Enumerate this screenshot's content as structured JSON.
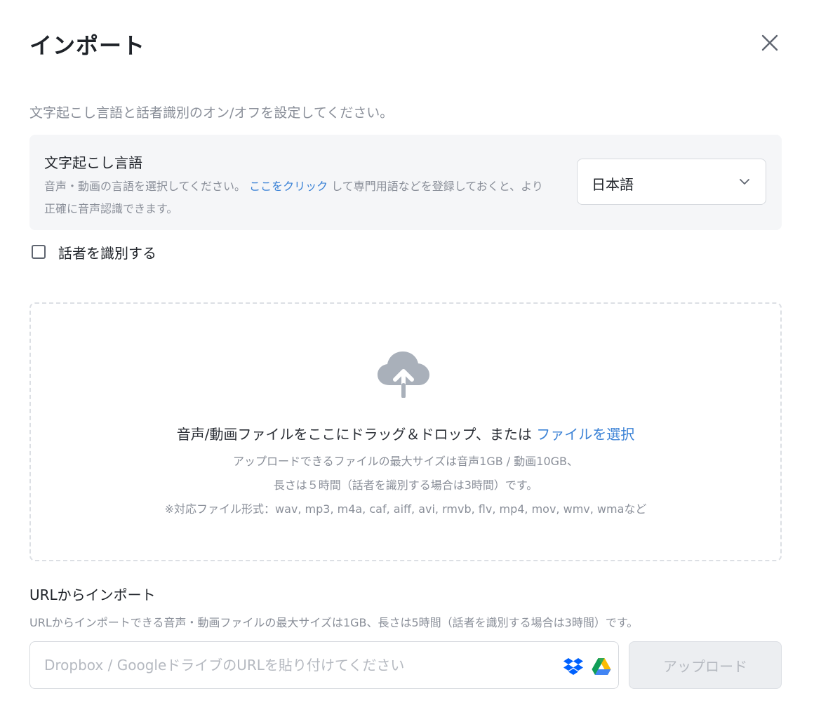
{
  "dialog": {
    "title": "インポート",
    "intro": "文字起こし言語と話者識別のオン/オフを設定してください。"
  },
  "language": {
    "title": "文字起こし言語",
    "desc_before": "音声・動画の言語を選択してください。",
    "desc_link": "ここをクリック",
    "desc_after": "して専門用語などを登録しておくと、より正確に音声認識できます。",
    "selected": "日本語"
  },
  "speaker": {
    "label": "話者を識別する",
    "checked": false
  },
  "dropzone": {
    "main_text": "音声/動画ファイルをここにドラッグ＆ドロップ、または",
    "main_link": "ファイルを選択",
    "info_line1": "アップロードできるファイルの最大サイズは音声1GB / 動画10GB、",
    "info_line2": "長さは５時間（話者を識別する場合は3時間）です。",
    "info_line3": "※対応ファイル形式：wav, mp3, m4a, caf, aiff, avi, rmvb, flv, mp4, mov, wmv, wmaなど"
  },
  "url_import": {
    "title": "URLからインポート",
    "desc": "URLからインポートできる音声・動画ファイルの最大サイズは1GB、長さは5時間（話者を識別する場合は3時間）です。",
    "placeholder": "Dropbox / GoogleドライブのURLを貼り付けてください",
    "value": "",
    "upload_label": "アップロード"
  },
  "icons": {
    "close": "close-icon",
    "chevron": "chevron-down-icon",
    "cloud": "cloud-upload-icon",
    "dropbox": "dropbox-icon",
    "gdrive": "google-drive-icon"
  },
  "colors": {
    "link": "#3b82d6",
    "muted": "#8a8f99",
    "panel_bg": "#f5f6f8",
    "cloud": "#a9b0ba",
    "dropbox": "#0061fe"
  }
}
